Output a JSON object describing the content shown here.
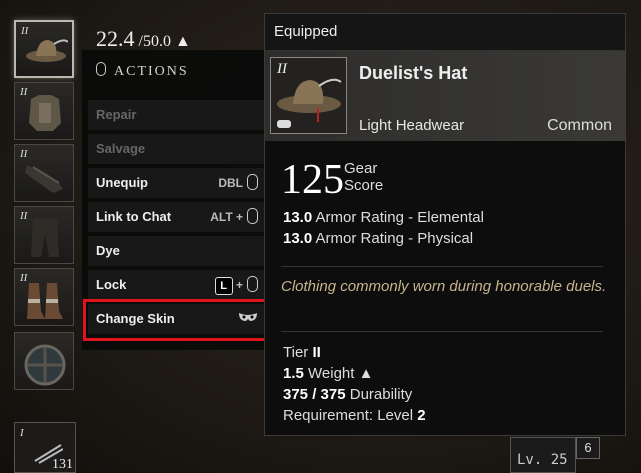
{
  "weight": {
    "current": "22.4",
    "max": "/50.0"
  },
  "slots": [
    {
      "tier": "II",
      "icon": "hat-icon"
    },
    {
      "tier": "II",
      "icon": "chest-armor-icon"
    },
    {
      "tier": "II",
      "icon": "gloves-icon"
    },
    {
      "tier": "II",
      "icon": "pants-icon"
    },
    {
      "tier": "II",
      "icon": "boots-icon"
    },
    {
      "tier": "",
      "icon": "round-shield-icon"
    }
  ],
  "bottom_slot": {
    "tier": "I",
    "qty": "131"
  },
  "actions": {
    "title": "ACTIONS",
    "items": [
      {
        "label": "Repair",
        "key": ""
      },
      {
        "label": "Salvage",
        "key": ""
      },
      {
        "label": "Unequip",
        "key": "DBL"
      },
      {
        "label": "Link to Chat",
        "key": "ALT +"
      },
      {
        "label": "Dye",
        "key": ""
      },
      {
        "label": "Lock",
        "key": "L"
      },
      {
        "label": "Change Skin",
        "key": ""
      }
    ],
    "plus": "+"
  },
  "tooltip": {
    "header": "Equipped",
    "icon_tier": "II",
    "name": "Duelist's Hat",
    "type": "Light Headwear",
    "rarity": "Common",
    "gear_score": "125",
    "gear_label_1": "Gear",
    "gear_label_2": "Score",
    "stats": [
      {
        "value": "13.0",
        "label": "Armor Rating - Elemental"
      },
      {
        "value": "13.0",
        "label": "Armor Rating - Physical"
      }
    ],
    "flavor": "Clothing commonly worn during honorable duels.",
    "tier_label": "Tier",
    "tier_value": "II",
    "weight_value": "1.5",
    "weight_label": "Weight",
    "durability_value": "375 / 375",
    "durability_label": "Durability",
    "req_label": "Requirement: Level",
    "req_value": "2"
  },
  "level": {
    "label": "Lv. 25",
    "badge": "6"
  }
}
